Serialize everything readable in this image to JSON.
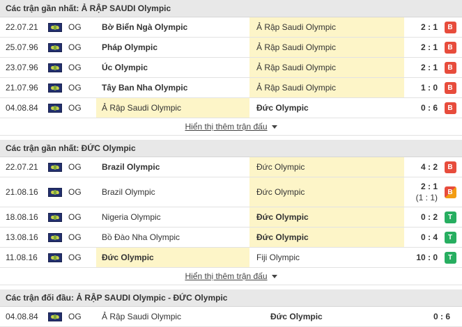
{
  "section1": {
    "title": "Các trận gần nhất: Ả RẬP SAUDI Olympic",
    "more": "Hiển thị thêm trận đấu",
    "rows": [
      {
        "date": "22.07.21",
        "comp": "OG",
        "home": "Bờ Biển Ngà Olympic",
        "away": "Ả Rập Saudi Olympic",
        "score": "2 : 1",
        "result": "B"
      },
      {
        "date": "25.07.96",
        "comp": "OG",
        "home": "Pháp Olympic",
        "away": "Ả Rập Saudi Olympic",
        "score": "2 : 1",
        "result": "B"
      },
      {
        "date": "23.07.96",
        "comp": "OG",
        "home": "Úc Olympic",
        "away": "Ả Rập Saudi Olympic",
        "score": "2 : 1",
        "result": "B"
      },
      {
        "date": "21.07.96",
        "comp": "OG",
        "home": "Tây Ban Nha Olympic",
        "away": "Ả Rập Saudi Olympic",
        "score": "1 : 0",
        "result": "B"
      },
      {
        "date": "04.08.84",
        "comp": "OG",
        "home": "Ả Rập Saudi Olympic",
        "away": "Đức Olympic",
        "score": "0 : 6",
        "result": "B"
      }
    ]
  },
  "section2": {
    "title": "Các trận gần nhất: ĐỨC Olympic",
    "more": "Hiển thị thêm trận đấu",
    "rows": [
      {
        "date": "22.07.21",
        "comp": "OG",
        "home": "Brazil Olympic",
        "away": "Đức Olympic",
        "score": "4 : 2",
        "result": "B"
      },
      {
        "date": "21.08.16",
        "comp": "OG",
        "home": "Brazil Olympic",
        "away": "Đức Olympic",
        "score": "2 : 1",
        "score_sub": "(1 : 1)",
        "result": "B"
      },
      {
        "date": "18.08.16",
        "comp": "OG",
        "home": "Nigeria Olympic",
        "away": "Đức Olympic",
        "score": "0 : 2",
        "result": "T"
      },
      {
        "date": "13.08.16",
        "comp": "OG",
        "home": "Bồ Đào Nha Olympic",
        "away": "Đức Olympic",
        "score": "0 : 4",
        "result": "T"
      },
      {
        "date": "11.08.16",
        "comp": "OG",
        "home": "Đức Olympic",
        "away": "Fiji Olympic",
        "score": "10 : 0",
        "result": "T"
      }
    ]
  },
  "section3": {
    "title": "Các trận đối đầu: Ả RẬP SAUDI Olympic - ĐỨC Olympic",
    "rows": [
      {
        "date": "04.08.84",
        "comp": "OG",
        "home": "Ả Rập Saudi Olympic",
        "away": "Đức Olympic",
        "score": "0 : 6"
      }
    ]
  },
  "colors": {
    "lose": "#e74c3c",
    "win": "#27ae60",
    "highlight": "#fdf5c8",
    "header": "#e8e8e8"
  }
}
